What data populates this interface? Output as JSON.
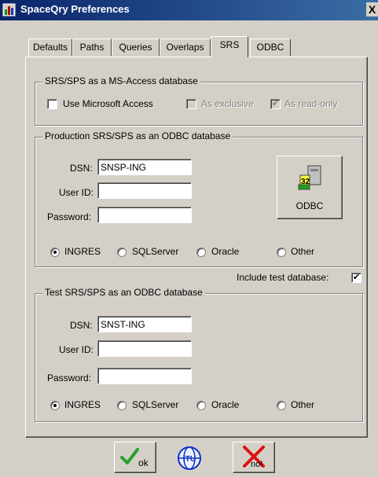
{
  "window": {
    "title": "SpaceQry Preferences",
    "close_glyph": "X"
  },
  "tabs": [
    {
      "label": "Defaults"
    },
    {
      "label": "Paths"
    },
    {
      "label": "Queries"
    },
    {
      "label": "Overlaps"
    },
    {
      "label": "SRS",
      "active": true
    },
    {
      "label": "ODBC"
    }
  ],
  "access_group": {
    "title": "SRS/SPS as a MS-Access database",
    "use_access": {
      "label": "Use Microsoft Access",
      "checked": false
    },
    "as_exclusive": {
      "label": "As exclusive",
      "checked": false,
      "enabled": false
    },
    "as_readonly": {
      "label": "As read-only",
      "checked": true,
      "enabled": false
    }
  },
  "production_group": {
    "title": "Production SRS/SPS as an ODBC database",
    "dsn_label": "DSN:",
    "dsn_value": "SNSP-ING",
    "userid_label": "User ID:",
    "userid_value": "",
    "password_label": "Password:",
    "password_value": "",
    "odbc_button_label": "ODBC",
    "odbc_icon_text": "32",
    "radios": [
      "INGRES",
      "SQLServer",
      "Oracle",
      "Other"
    ],
    "selected": "INGRES"
  },
  "include_test": {
    "label": "Include test database:",
    "checked": true
  },
  "test_group": {
    "title": "Test SRS/SPS as an ODBC database",
    "dsn_label": "DSN:",
    "dsn_value": "SNST-ING",
    "userid_label": "User ID:",
    "userid_value": "",
    "password_label": "Password:",
    "password_value": "",
    "radios": [
      "INGRES",
      "SQLServer",
      "Oracle",
      "Other"
    ],
    "selected": "INGRES"
  },
  "footer": {
    "ok_label": "ok",
    "help_icon_text": "ITU",
    "cancel_label": "no!"
  }
}
